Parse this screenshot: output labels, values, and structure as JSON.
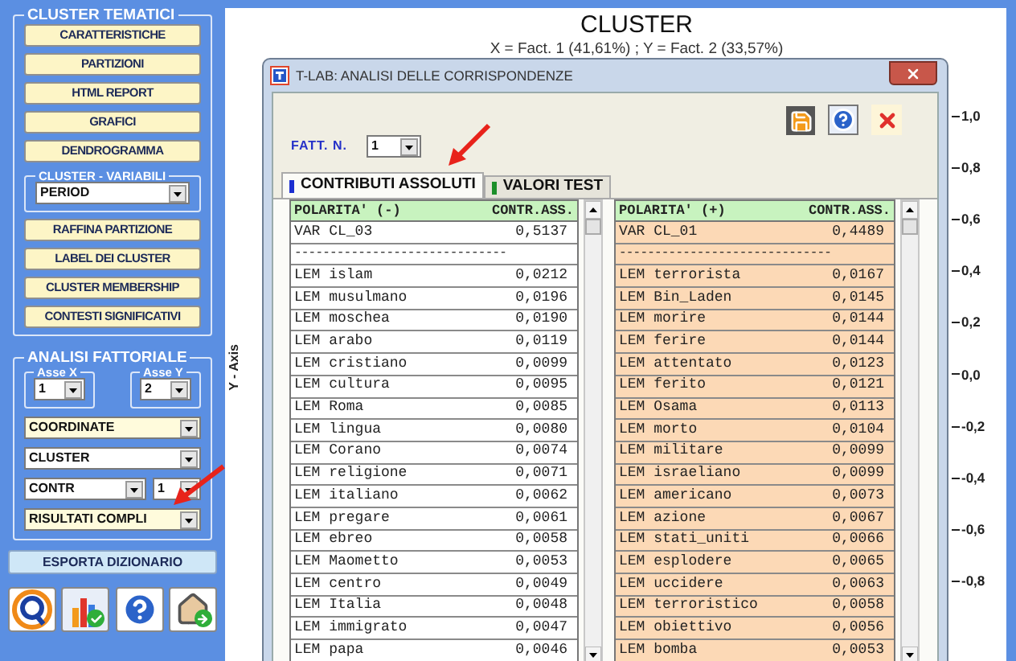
{
  "cluster_tematici": {
    "title": "CLUSTER TEMATICI",
    "buttons": [
      "CARATTERISTICHE",
      "PARTIZIONI",
      "HTML REPORT",
      "GRAFICI",
      "DENDROGRAMMA"
    ],
    "variabili": {
      "title": "CLUSTER - VARIABILI",
      "value": "PERIOD"
    },
    "buttons_2": [
      "RAFFINA PARTIZIONE",
      "LABEL DEI CLUSTER",
      "CLUSTER MEMBERSHIP",
      "CONTESTI SIGNIFICATIVI"
    ]
  },
  "analisi_fattoriale": {
    "title": "ANALISI FATTORIALE",
    "asse_x": {
      "label": "Asse X",
      "value": "1"
    },
    "asse_y": {
      "label": "Asse Y",
      "value": "2"
    },
    "selects": [
      {
        "kind": "select",
        "value": "COORDINATE",
        "highlighted": true
      },
      {
        "kind": "select",
        "value": "CLUSTER",
        "highlighted": false
      },
      {
        "kind": "pair",
        "value": "CONTR",
        "number": "1",
        "highlighted": false
      },
      {
        "kind": "select",
        "value": "RISULTATI COMPLI",
        "highlighted": true
      }
    ]
  },
  "export_button": "ESPORTA DIZIONARIO",
  "chart": {
    "title": "CLUSTER",
    "subtitle": "X = Fact. 1 (41,61%) ; Y = Fact. 2 (33,57%)",
    "y_axis": {
      "title": "Y - Axis",
      "ticks": [
        "1,0",
        "0,8",
        "0,6",
        "0,4",
        "0,2",
        "0,0",
        "-0,2",
        "-0,4",
        "-0,6",
        "-0,8"
      ]
    }
  },
  "dialog": {
    "title": "T-LAB: ANALISI DELLE CORRISPONDENZE",
    "fatt_label": "FATT. N.",
    "fatt_value": "1",
    "tabs": [
      {
        "label": "CONTRIBUTI ASSOLUTI",
        "selected": true
      },
      {
        "label": "VALORI TEST",
        "selected": false
      }
    ],
    "tables": [
      {
        "color": "#ffffff",
        "columns": [
          "POLARITA' (-)",
          "CONTR.ASS."
        ],
        "rows": [
          {
            "kind": "row",
            "label": "VAR CL_03",
            "value": "0,5137"
          },
          {
            "kind": "separator",
            "label": "------------------------------"
          },
          {
            "kind": "row",
            "label": "LEM islam",
            "value": "0,0212"
          },
          {
            "kind": "row",
            "label": "LEM musulmano",
            "value": "0,0196"
          },
          {
            "kind": "row",
            "label": "LEM moschea",
            "value": "0,0190"
          },
          {
            "kind": "row",
            "label": "LEM arabo",
            "value": "0,0119"
          },
          {
            "kind": "row",
            "label": "LEM cristiano",
            "value": "0,0099"
          },
          {
            "kind": "row",
            "label": "LEM cultura",
            "value": "0,0095"
          },
          {
            "kind": "row",
            "label": "LEM Roma",
            "value": "0,0085"
          },
          {
            "kind": "row",
            "label": "LEM lingua",
            "value": "0,0080"
          },
          {
            "kind": "row",
            "label": "LEM Corano",
            "value": "0,0074"
          },
          {
            "kind": "row",
            "label": "LEM religione",
            "value": "0,0071"
          },
          {
            "kind": "row",
            "label": "LEM italiano",
            "value": "0,0062"
          },
          {
            "kind": "row",
            "label": "LEM pregare",
            "value": "0,0061"
          },
          {
            "kind": "row",
            "label": "LEM ebreo",
            "value": "0,0058"
          },
          {
            "kind": "row",
            "label": "LEM Maometto",
            "value": "0,0053"
          },
          {
            "kind": "row",
            "label": "LEM centro",
            "value": "0,0049"
          },
          {
            "kind": "row",
            "label": "LEM Italia",
            "value": "0,0048"
          },
          {
            "kind": "row",
            "label": "LEM immigrato",
            "value": "0,0047"
          },
          {
            "kind": "row",
            "label": "LEM papa",
            "value": "0,0046"
          }
        ]
      },
      {
        "color": "#fcd9b6",
        "columns": [
          "POLARITA' (+)",
          "CONTR.ASS."
        ],
        "rows": [
          {
            "kind": "row",
            "label": "VAR CL_01",
            "value": "0,4489"
          },
          {
            "kind": "separator",
            "label": "------------------------------"
          },
          {
            "kind": "row",
            "label": "LEM terrorista",
            "value": "0,0167"
          },
          {
            "kind": "row",
            "label": "LEM Bin_Laden",
            "value": "0,0145"
          },
          {
            "kind": "row",
            "label": "LEM morire",
            "value": "0,0144"
          },
          {
            "kind": "row",
            "label": "LEM ferire",
            "value": "0,0144"
          },
          {
            "kind": "row",
            "label": "LEM attentato",
            "value": "0,0123"
          },
          {
            "kind": "row",
            "label": "LEM ferito",
            "value": "0,0121"
          },
          {
            "kind": "row",
            "label": "LEM Osama",
            "value": "0,0113"
          },
          {
            "kind": "row",
            "label": "LEM morto",
            "value": "0,0104"
          },
          {
            "kind": "row",
            "label": "LEM militare",
            "value": "0,0099"
          },
          {
            "kind": "row",
            "label": "LEM israeliano",
            "value": "0,0099"
          },
          {
            "kind": "row",
            "label": "LEM americano",
            "value": "0,0073"
          },
          {
            "kind": "row",
            "label": "LEM azione",
            "value": "0,0067"
          },
          {
            "kind": "row",
            "label": "LEM stati_uniti",
            "value": "0,0066"
          },
          {
            "kind": "row",
            "label": "LEM esplodere",
            "value": "0,0065"
          },
          {
            "kind": "row",
            "label": "LEM uccidere",
            "value": "0,0063"
          },
          {
            "kind": "row",
            "label": "LEM terroristico",
            "value": "0,0058"
          },
          {
            "kind": "row",
            "label": "LEM obiettivo",
            "value": "0,0056"
          },
          {
            "kind": "row",
            "label": "LEM bomba",
            "value": "0,0053"
          }
        ]
      }
    ]
  }
}
